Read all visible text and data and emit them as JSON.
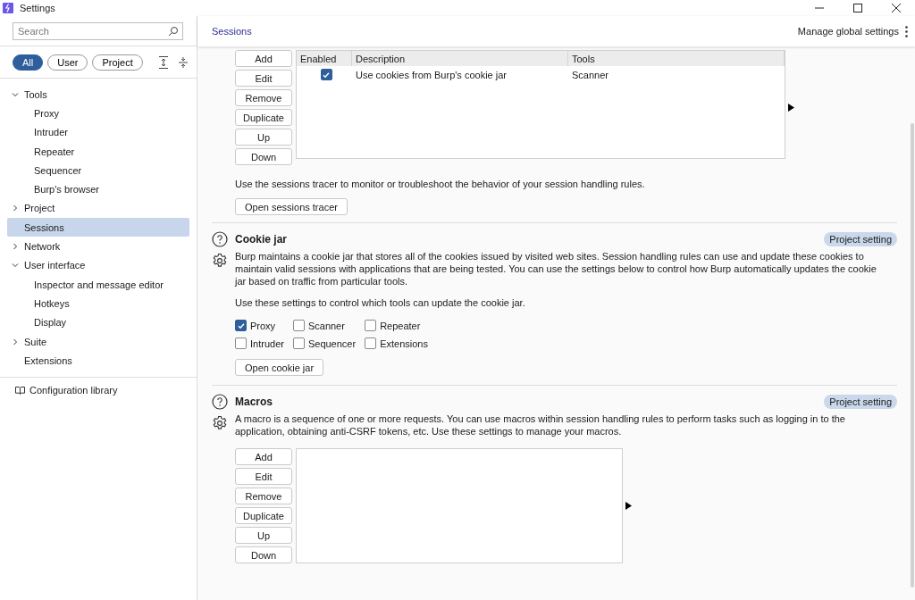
{
  "window": {
    "title": "Settings"
  },
  "sidebar": {
    "search": {
      "placeholder": "Search"
    },
    "filters": [
      {
        "label": "All",
        "selected": true
      },
      {
        "label": "User",
        "selected": false
      },
      {
        "label": "Project",
        "selected": false
      }
    ],
    "tree": [
      {
        "label": "Tools",
        "expanded": true,
        "selected": false,
        "children": [
          {
            "label": "Proxy",
            "selected": false
          },
          {
            "label": "Intruder",
            "selected": false
          },
          {
            "label": "Repeater",
            "selected": false
          },
          {
            "label": "Sequencer",
            "selected": false
          },
          {
            "label": "Burp's browser",
            "selected": false
          }
        ]
      },
      {
        "label": "Project",
        "expanded": false,
        "selected": false
      },
      {
        "label": "Sessions",
        "selected": true
      },
      {
        "label": "Network",
        "expanded": false,
        "selected": false
      },
      {
        "label": "User interface",
        "expanded": true,
        "selected": false,
        "children": [
          {
            "label": "Inspector and message editor",
            "selected": false
          },
          {
            "label": "Hotkeys",
            "selected": false
          },
          {
            "label": "Display",
            "selected": false
          }
        ]
      },
      {
        "label": "Suite",
        "expanded": false,
        "selected": false
      },
      {
        "label": "Extensions",
        "selected": false
      }
    ],
    "library": "Configuration library"
  },
  "header": {
    "title": "Sessions",
    "action": "Manage global settings"
  },
  "session_rules": {
    "buttons": [
      "Add",
      "Edit",
      "Remove",
      "Duplicate",
      "Up",
      "Down"
    ],
    "columns": [
      "Enabled",
      "Description",
      "Tools"
    ],
    "rows": [
      {
        "enabled": true,
        "description": "Use cookies from Burp's cookie jar",
        "tools": "Scanner"
      }
    ],
    "note": "Use the sessions tracer to monitor or troubleshoot the behavior of your session handling rules.",
    "action": "Open sessions tracer"
  },
  "cookie_jar": {
    "title": "Cookie jar",
    "badge": "Project setting",
    "description": "Burp maintains a cookie jar that stores all of the cookies issued by visited web sites. Session handling rules can use and update these cookies to maintain valid sessions with applications that are being tested. You can use the settings below to control how Burp automatically updates the cookie jar based on traffic from particular tools.",
    "hint": "Use these settings to control which tools can update the cookie jar.",
    "tools": [
      {
        "label": "Proxy",
        "checked": true
      },
      {
        "label": "Scanner",
        "checked": false
      },
      {
        "label": "Repeater",
        "checked": false
      },
      {
        "label": "Intruder",
        "checked": false
      },
      {
        "label": "Sequencer",
        "checked": false
      },
      {
        "label": "Extensions",
        "checked": false
      }
    ],
    "action": "Open cookie jar"
  },
  "macros": {
    "title": "Macros",
    "badge": "Project setting",
    "description": "A macro is a sequence of one or more requests. You can use macros within session handling rules to perform tasks such as logging in to the application, obtaining anti-CSRF tokens, etc. Use these settings to manage your macros.",
    "buttons": [
      "Add",
      "Edit",
      "Remove",
      "Duplicate",
      "Up",
      "Down"
    ]
  }
}
